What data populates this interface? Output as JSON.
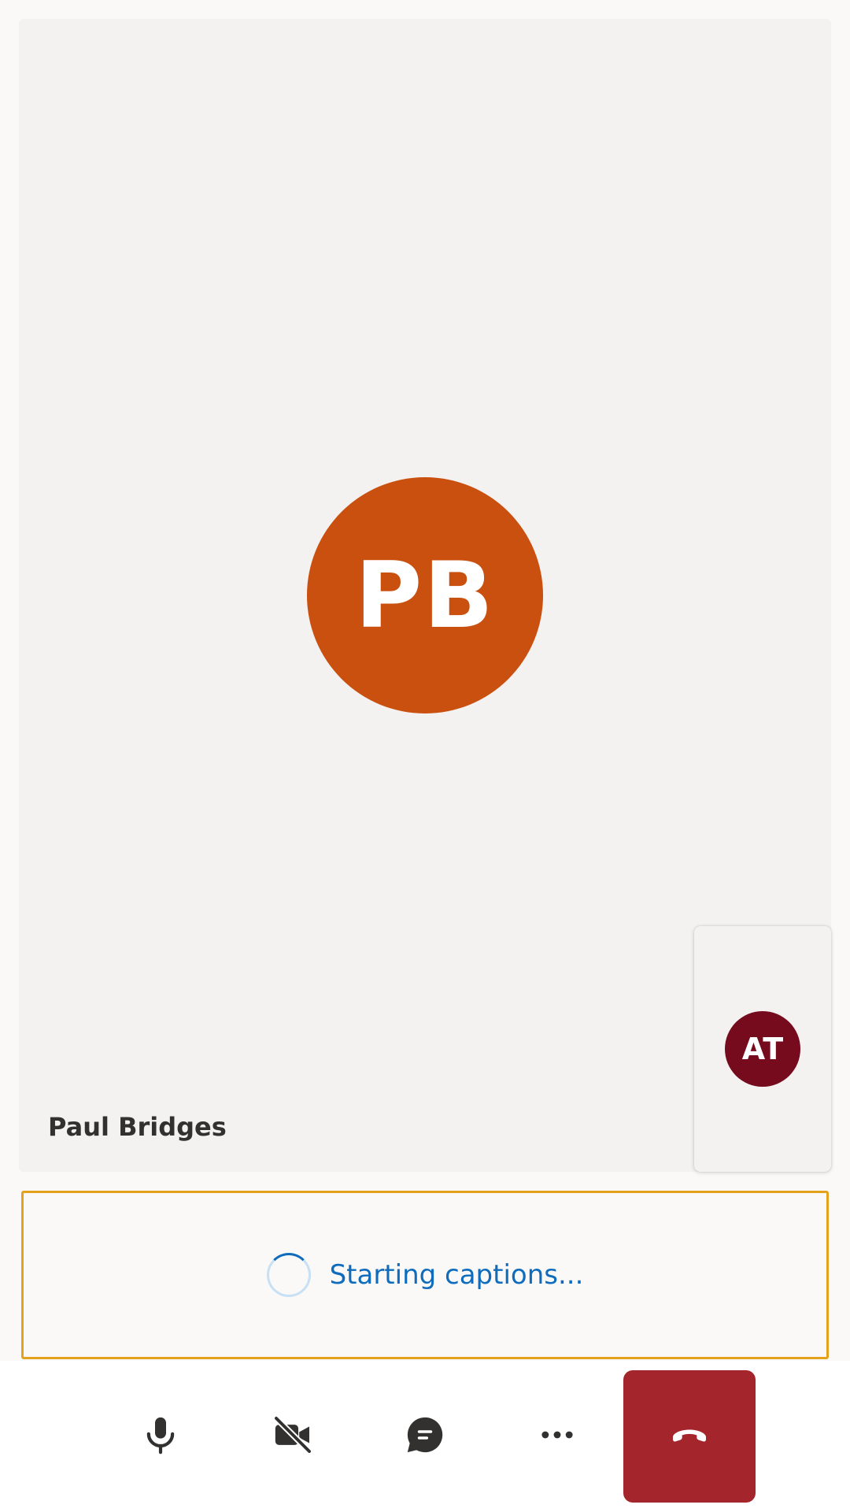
{
  "stage": {
    "participant": {
      "initials": "PB",
      "name": "Paul Bridges",
      "avatar_color": "#ca5010"
    }
  },
  "self_preview": {
    "initials": "AT",
    "avatar_color": "#750b1c"
  },
  "captions": {
    "status_text": "Starting captions...",
    "border_color": "#e3a21a",
    "text_color": "#0f6cbd"
  },
  "controls": {
    "items": [
      {
        "name": "microphone-button",
        "icon": "microphone-icon"
      },
      {
        "name": "camera-button",
        "icon": "video-off-icon"
      },
      {
        "name": "chat-button",
        "icon": "chat-icon"
      },
      {
        "name": "more-options-button",
        "icon": "more-horizontal-icon"
      },
      {
        "name": "hang-up-button",
        "icon": "phone-hang-up-icon"
      }
    ],
    "hangup_color": "#a4262c"
  },
  "colors": {
    "background": "#faf9f8",
    "tile_background": "#f3f2f1",
    "icon_color": "#323130"
  }
}
